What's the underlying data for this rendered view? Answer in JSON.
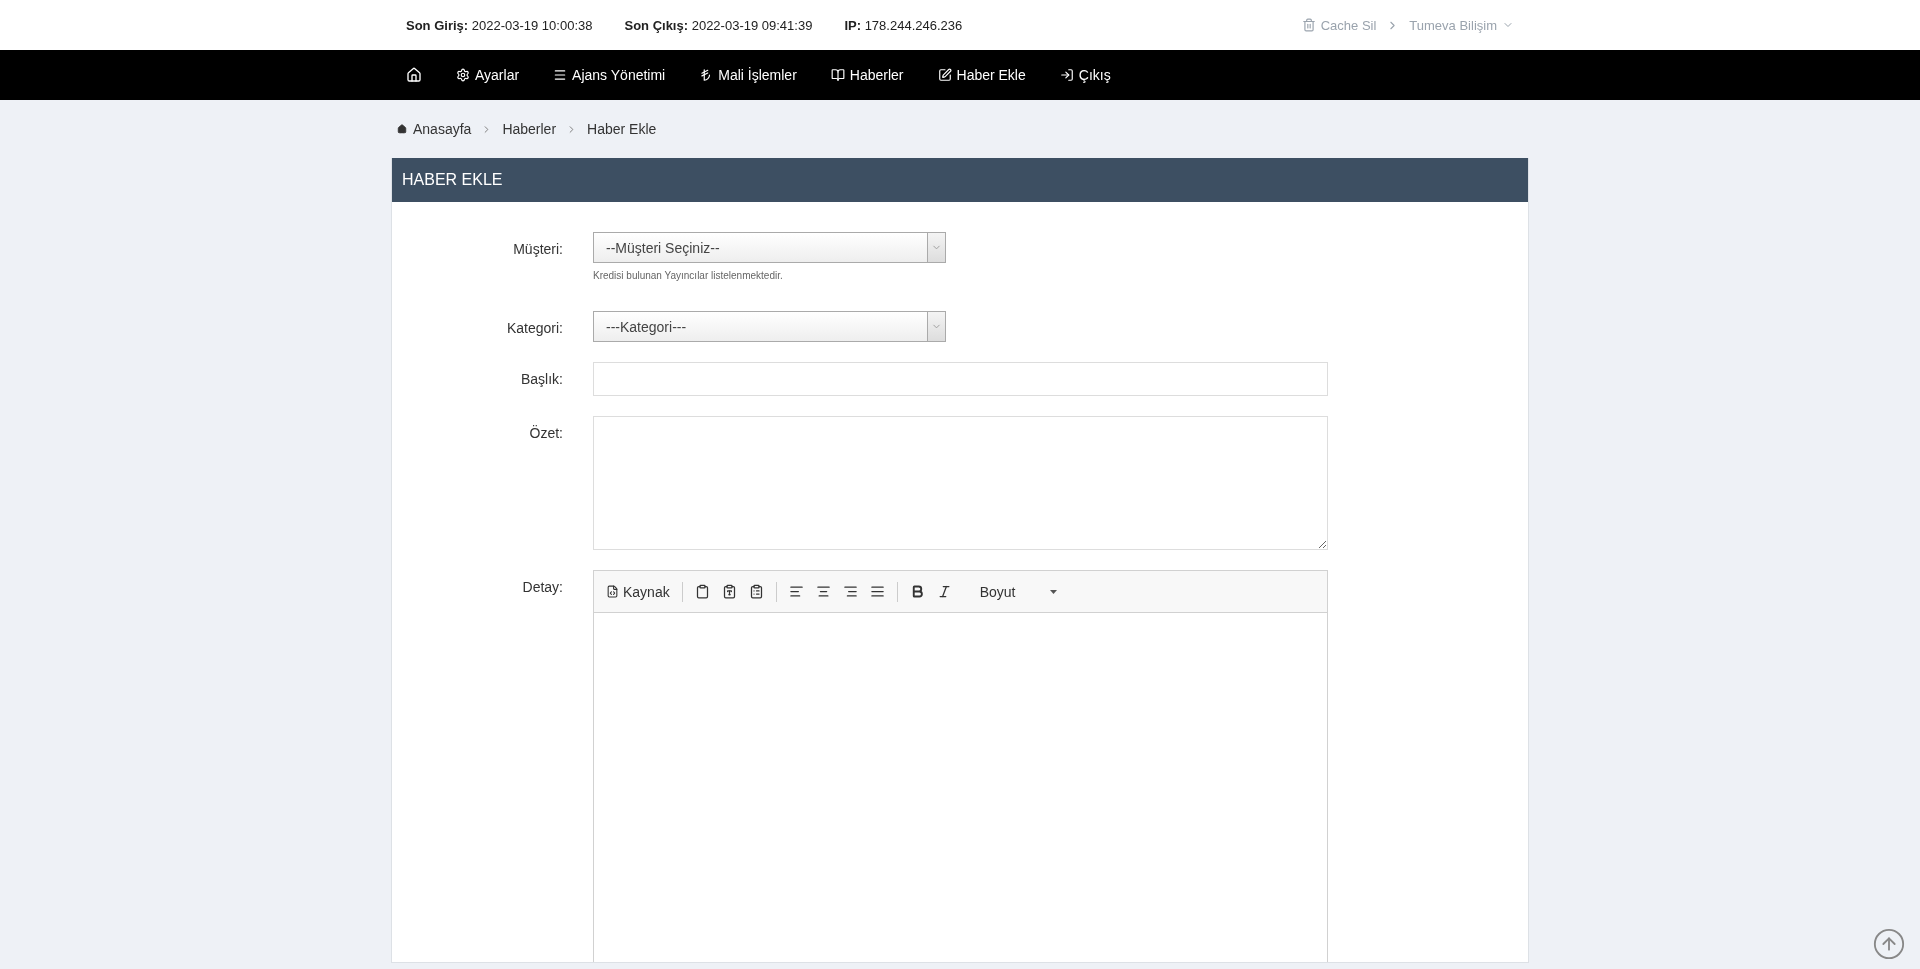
{
  "top_bar": {
    "stats": [
      {
        "label": "Son Giriş:",
        "value": "2022-03-19 10:00:38"
      },
      {
        "label": "Son Çıkış:",
        "value": "2022-03-19 09:41:39"
      },
      {
        "label": "IP:",
        "value": "178.244.246.236"
      }
    ],
    "cache_link": "Cache Sil",
    "user_menu": "Tumeva Bilişim"
  },
  "nav": {
    "items": [
      {
        "label": "Ayarlar"
      },
      {
        "label": "Ajans Yönetimi"
      },
      {
        "label": "Mali İşlemler"
      },
      {
        "label": "Haberler"
      },
      {
        "label": "Haber Ekle"
      },
      {
        "label": "Çıkış"
      }
    ]
  },
  "breadcrumb": [
    "Anasayfa",
    "Haberler",
    "Haber Ekle"
  ],
  "panel": {
    "title": "HABER EKLE",
    "fields": [
      {
        "kind": "select",
        "label": "Müşteri:",
        "value": "--Müşteri Seçiniz--",
        "help": "Kredisi bulunan Yayıncılar listelenmektedir."
      },
      {
        "kind": "select",
        "label": "Kategori:",
        "value": "---Kategori---"
      },
      {
        "kind": "input",
        "label": "Başlık:"
      },
      {
        "kind": "textarea",
        "label": "Özet:"
      },
      {
        "kind": "editor",
        "label": "Detay:",
        "source_button": "Kaynak",
        "size_dropdown": "Boyut"
      }
    ]
  }
}
